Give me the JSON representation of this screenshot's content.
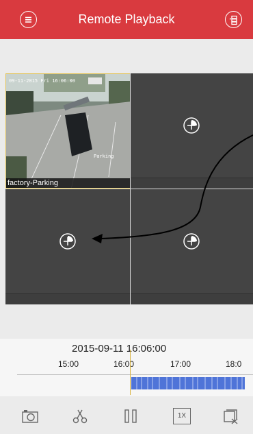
{
  "header": {
    "title": "Remote Playback",
    "menu_icon": "menu-icon",
    "list_icon": "playlist-icon"
  },
  "grid": {
    "camera": {
      "name": "factory-Parking",
      "osd_time": "09-11-2015 Fri 16:06:00",
      "osd_label": "Parking"
    },
    "empty_windows": [
      {
        "id": "window-2",
        "icon": "add-camera-icon"
      },
      {
        "id": "window-3",
        "icon": "add-camera-icon"
      },
      {
        "id": "window-4",
        "icon": "add-camera-icon"
      }
    ]
  },
  "timeline": {
    "current": "2015-09-11 16:06:00",
    "ticks": [
      "15:00",
      "16:00",
      "17:00",
      "18:0"
    ]
  },
  "toolbar": {
    "items": [
      {
        "name": "capture-button",
        "icon": "camera-icon"
      },
      {
        "name": "clip-button",
        "icon": "scissors-icon"
      },
      {
        "name": "pause-button",
        "icon": "pause-icon"
      },
      {
        "name": "speed-button",
        "icon": "speed-icon",
        "label": "1X"
      },
      {
        "name": "stop-all-button",
        "icon": "close-all-icon"
      }
    ]
  },
  "colors": {
    "header": "#d93a3f",
    "selected_border": "#e4c354",
    "record_bar": "#4f74d8"
  }
}
